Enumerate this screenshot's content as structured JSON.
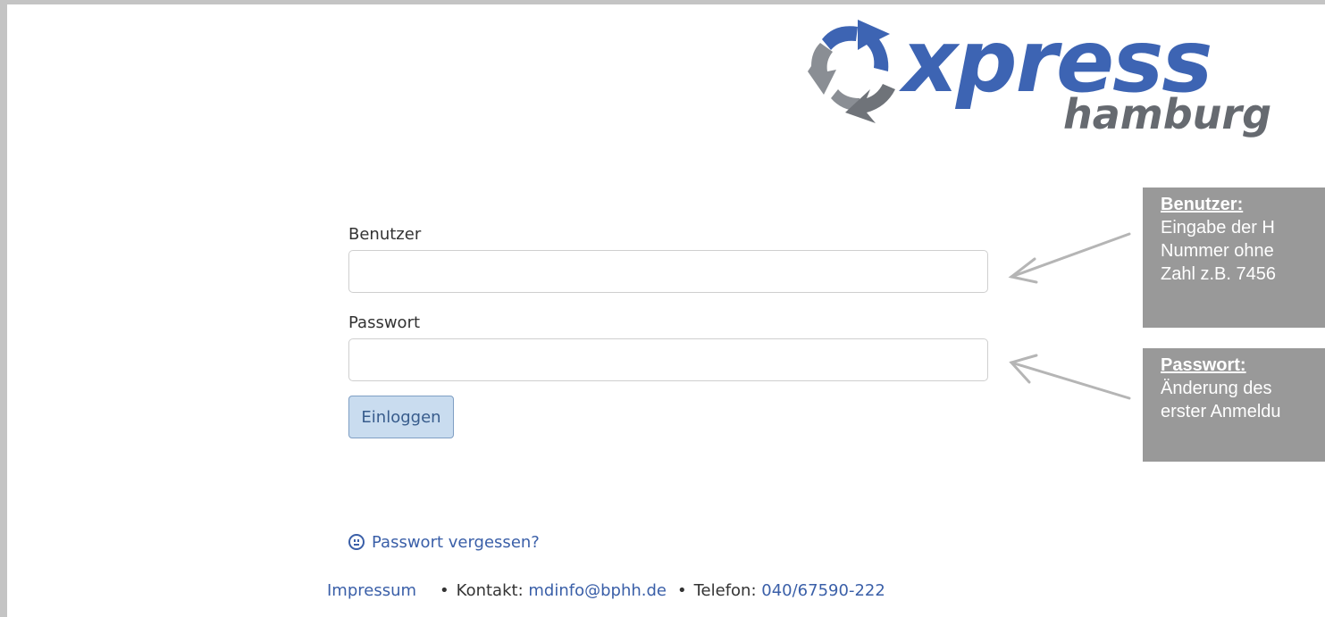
{
  "logo": {
    "brand": "xpress",
    "sub": "hamburg",
    "icon": "recycle-arrows-icon",
    "colors": {
      "blue": "#3d64b3",
      "gray": "#666a70"
    }
  },
  "form": {
    "username_label": "Benutzer",
    "username_value": "",
    "password_label": "Passwort",
    "password_value": "",
    "login_button": "Einloggen"
  },
  "forgot": {
    "icon": "confused-face-icon",
    "label": "Passwort vergessen?"
  },
  "footer": {
    "impressum": "Impressum",
    "contact_label": "Kontakt:",
    "contact_email": "mdinfo@bphh.de",
    "phone_label": "Telefon:",
    "phone_number": "040/67590-222"
  },
  "notes": {
    "user": {
      "title": "Benutzer:",
      "lines": [
        "Eingabe der H",
        "Nummer ohne",
        "Zahl z.B. 7456"
      ]
    },
    "password": {
      "title": "Passwort:",
      "lines": [
        "Änderung des",
        "erster Anmeldu"
      ]
    }
  },
  "colors": {
    "link": "#3a5fa8",
    "note_bg": "#999999",
    "button_bg": "#c9dcef"
  }
}
